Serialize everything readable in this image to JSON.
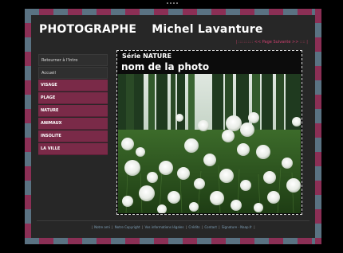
{
  "header": {
    "title": "PHOTOGRAPHE",
    "name": "Michel Lavanture"
  },
  "photo_nav": {
    "prefix": "| ::::::::::: ",
    "next": "<< Page Suivante >>",
    "suffix": " :::: |"
  },
  "sidebar": {
    "items": [
      {
        "label": "Retourner à l'Intro",
        "style": "dark"
      },
      {
        "label": "Accueil",
        "style": "dark"
      },
      {
        "label": "VISAGE",
        "style": "accent"
      },
      {
        "label": "PLAGE",
        "style": "accent"
      },
      {
        "label": "NATURE",
        "style": "accent"
      },
      {
        "label": "ANIMAUX",
        "style": "accent"
      },
      {
        "label": "INSOLITE",
        "style": "accent"
      },
      {
        "label": "LA VILLE",
        "style": "accent"
      }
    ]
  },
  "photo": {
    "serie": "Série NATURE",
    "name": "nom de la photo"
  },
  "footer": {
    "links": [
      "Notre ami",
      "Notre Copyright",
      "Vos informations légales",
      "Crédits",
      "Contact",
      "Signature - Naap.fr"
    ]
  },
  "colors": {
    "accent": "#7a2a48",
    "frame_blue": "#5a7282",
    "frame_pink": "#8b2f55",
    "background": "#272727"
  }
}
